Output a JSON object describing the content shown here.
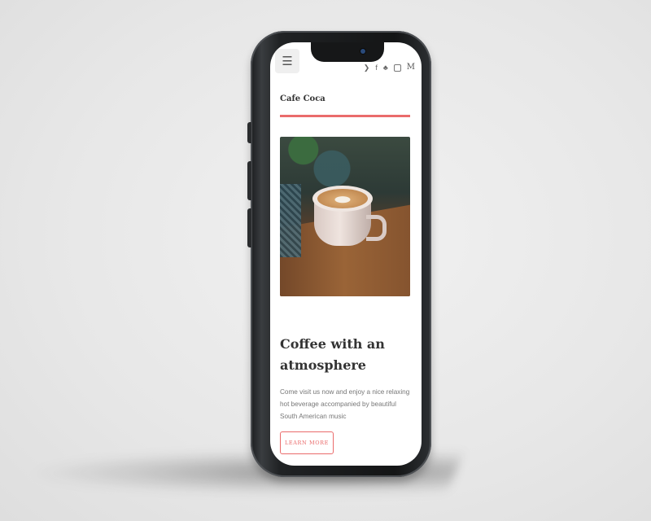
{
  "site": {
    "brand": "Cafe Coca",
    "accent_color": "#ea6b6b"
  },
  "header": {
    "menu_icon": "☰",
    "social_icons": [
      "twitter-icon",
      "facebook-icon",
      "snapchat-icon",
      "instagram-icon",
      "medium-icon"
    ],
    "medium_glyph": "M"
  },
  "hero": {
    "headline": "Coffee with an atmosphere",
    "description": "Come visit us now and enjoy a nice relaxing hot beverage accompanied by beautiful South American music",
    "cta_label": "LEARN MORE",
    "image_subject": "latte-art-coffee-cup"
  }
}
